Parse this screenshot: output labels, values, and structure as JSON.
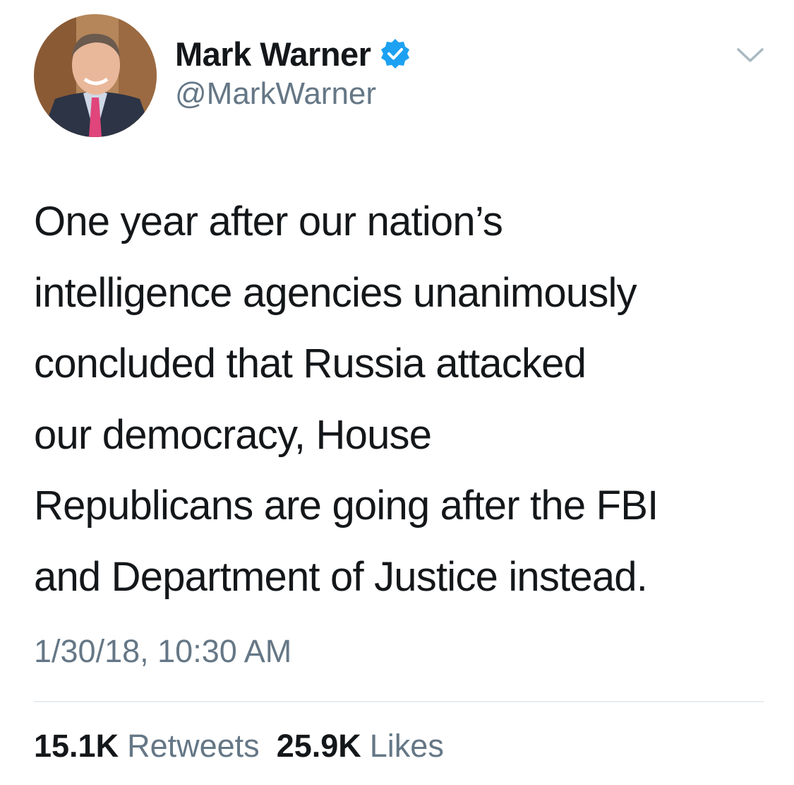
{
  "user": {
    "display_name": "Mark Warner",
    "handle": "@MarkWarner",
    "verified": true
  },
  "tweet": {
    "text_lines": [
      "One year after our nation’s",
      "intelligence agencies unanimously",
      "concluded that Russia attacked",
      "our democracy, House",
      "Republicans are going after the FBI",
      "and Department of Justice instead."
    ],
    "timestamp": "1/30/18, 10:30 AM"
  },
  "stats": {
    "retweets_count": "15.1K",
    "retweets_label": "Retweets",
    "likes_count": "25.9K",
    "likes_label": "Likes"
  },
  "icons": {
    "verified": "verified-badge-icon",
    "menu": "chevron-down-icon"
  },
  "colors": {
    "text_primary": "#14171a",
    "text_secondary": "#657786",
    "verified_blue": "#1da1f2",
    "divider": "#e6ecf0"
  }
}
